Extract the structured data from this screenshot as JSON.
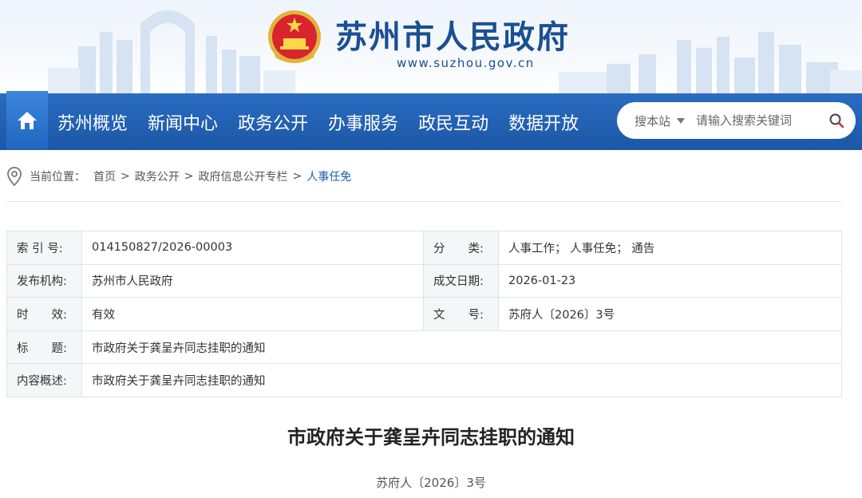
{
  "header": {
    "site_title": "苏州市人民政府",
    "site_url": "www.suzhou.gov.cn"
  },
  "nav": {
    "home_icon": "home-icon",
    "items": [
      "苏州概览",
      "新闻中心",
      "政务公开",
      "办事服务",
      "政民互动",
      "数据开放"
    ]
  },
  "search": {
    "scope": "搜本站",
    "placeholder": "请输入搜索关键词",
    "icon": "search-icon"
  },
  "breadcrumb": {
    "prefix": "当前位置：",
    "items": [
      "首页",
      "政务公开",
      "政府信息公开专栏"
    ],
    "separator": ">",
    "current": "人事任免"
  },
  "info": {
    "index_label": "索 引 号:",
    "index_value": "014150827/2026-00003",
    "category_label": "分　　类:",
    "category_value": "人事工作；  人事任免；  通告",
    "publisher_label": "发布机构:",
    "publisher_value": "苏州市人民政府",
    "date_label": "成文日期:",
    "date_value": "2026-01-23",
    "validity_label": "时　　效:",
    "validity_value": "有效",
    "docno_label": "文　　号:",
    "docno_value": "苏府人〔2026〕3号",
    "title_label": "标　　题:",
    "title_value": "市政府关于龚呈卉同志挂职的通知",
    "summary_label": "内容概述:",
    "summary_value": "市政府关于龚呈卉同志挂职的通知"
  },
  "article": {
    "title": "市政府关于龚呈卉同志挂职的通知",
    "doc_number": "苏府人〔2026〕3号"
  },
  "colors": {
    "brand": "#1b4f93",
    "nav_bg": "#1c57a6",
    "link_current": "#1b5fb3"
  }
}
